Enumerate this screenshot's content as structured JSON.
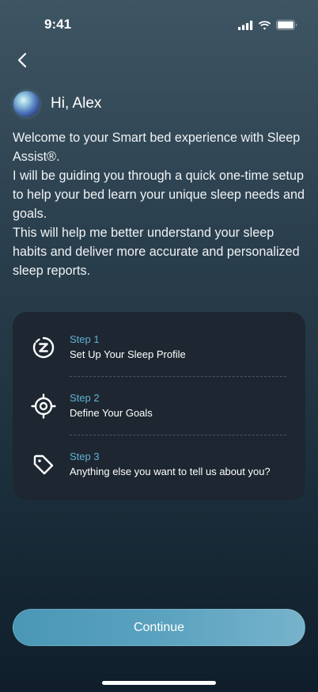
{
  "status_bar": {
    "time": "9:41",
    "icons": [
      "cellular-signal-icon",
      "wifi-icon",
      "battery-icon"
    ]
  },
  "header": {
    "back_icon": "chevron-left-icon"
  },
  "greeting": {
    "avatar": "assistant-orb-avatar",
    "text": "Hi, Alex"
  },
  "intro": {
    "paragraphs": [
      "Welcome to your Smart bed experience with Sleep Assist®.",
      "I will be guiding you through a quick one-time setup to help your bed learn your unique sleep needs and goals.",
      "This will help me better understand your sleep habits and deliver more accurate and personalized sleep reports."
    ]
  },
  "steps": [
    {
      "number": "Step 1",
      "title": "Set Up Your Sleep Profile",
      "icon": "sleep-z-icon"
    },
    {
      "number": "Step 2",
      "title": "Define Your Goals",
      "icon": "target-icon"
    },
    {
      "number": "Step 3",
      "title": "Anything else you want to tell us about you?",
      "icon": "tag-icon"
    }
  ],
  "footer": {
    "continue_label": "Continue"
  },
  "colors": {
    "accent": "#5fb1d2",
    "card_background": "#1e2731",
    "button_gradient_start": "#4a97b6",
    "button_gradient_end": "#77b3cb"
  }
}
